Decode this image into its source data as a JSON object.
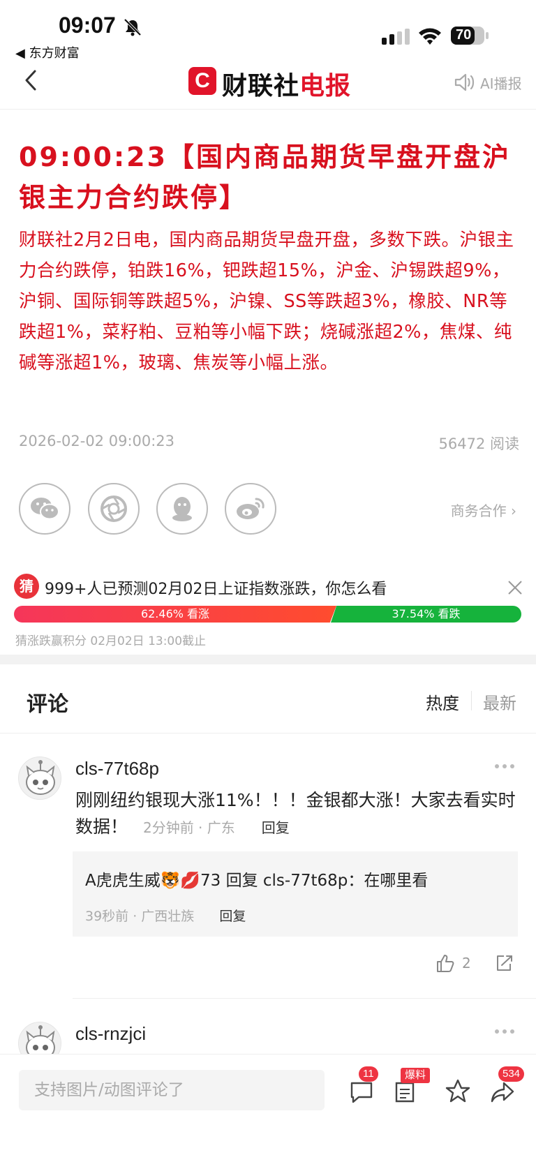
{
  "status_bar": {
    "time": "09:07",
    "back_app": "◀ 东方财富",
    "battery": "70"
  },
  "nav": {
    "logo_letter": "C",
    "logo_text_black": "财联社",
    "logo_text_red": "电报",
    "ai_label": "AI播报"
  },
  "article": {
    "headline": "09:00:23【国内商品期货早盘开盘沪银主力合约跌停】",
    "body": "财联社2月2日电，国内商品期货早盘开盘，多数下跌。沪银主力合约跌停，铂跌16%，钯跌超15%，沪金、沪锡跌超9%，沪铜、国际铜等跌超5%，沪镍、SS等跌超3%，橡胶、NR等跌超1%，菜籽粕、豆粕等小幅下跌；烧碱涨超2%，焦煤、纯碱等涨超1%，玻璃、焦炭等小幅上涨。",
    "date": "2026-02-02 09:00:23",
    "reads": "56472 阅读"
  },
  "share": {
    "icons": [
      "wechat-icon",
      "moments-icon",
      "qq-icon",
      "weibo-icon"
    ],
    "business": "商务合作 ›"
  },
  "poll": {
    "badge": "猜",
    "question": "999+人已预测02月02日上证指数涨跌，你怎么看",
    "up_label": "62.46% 看涨",
    "down_label": "37.54% 看跌",
    "up_fraction": 0.6246,
    "footer": "猜涨跌赢积分   02月02日 13:00截止"
  },
  "comments": {
    "title": "评论",
    "sort_hot": "热度",
    "sort_new": "最新",
    "items": [
      {
        "user": "cls-77t68p",
        "text": "刚刚纽约银现大涨11%！！！金银都大涨！大家去看实时数据！",
        "meta": "2分钟前 · 广东",
        "reply_label": "回复",
        "reply": {
          "line": "A虎虎生威🐯💋73 回复 cls-77t68p：在哪里看",
          "meta": "39秒前 · 广西壮族",
          "reply_label": "回复"
        },
        "likes": "2"
      },
      {
        "user": "cls-rnzjci"
      }
    ]
  },
  "bottom_bar": {
    "input_placeholder": "支持图片/动图评论了",
    "comment_badge": "11",
    "news_badge": "爆料",
    "share_badge": "534"
  }
}
